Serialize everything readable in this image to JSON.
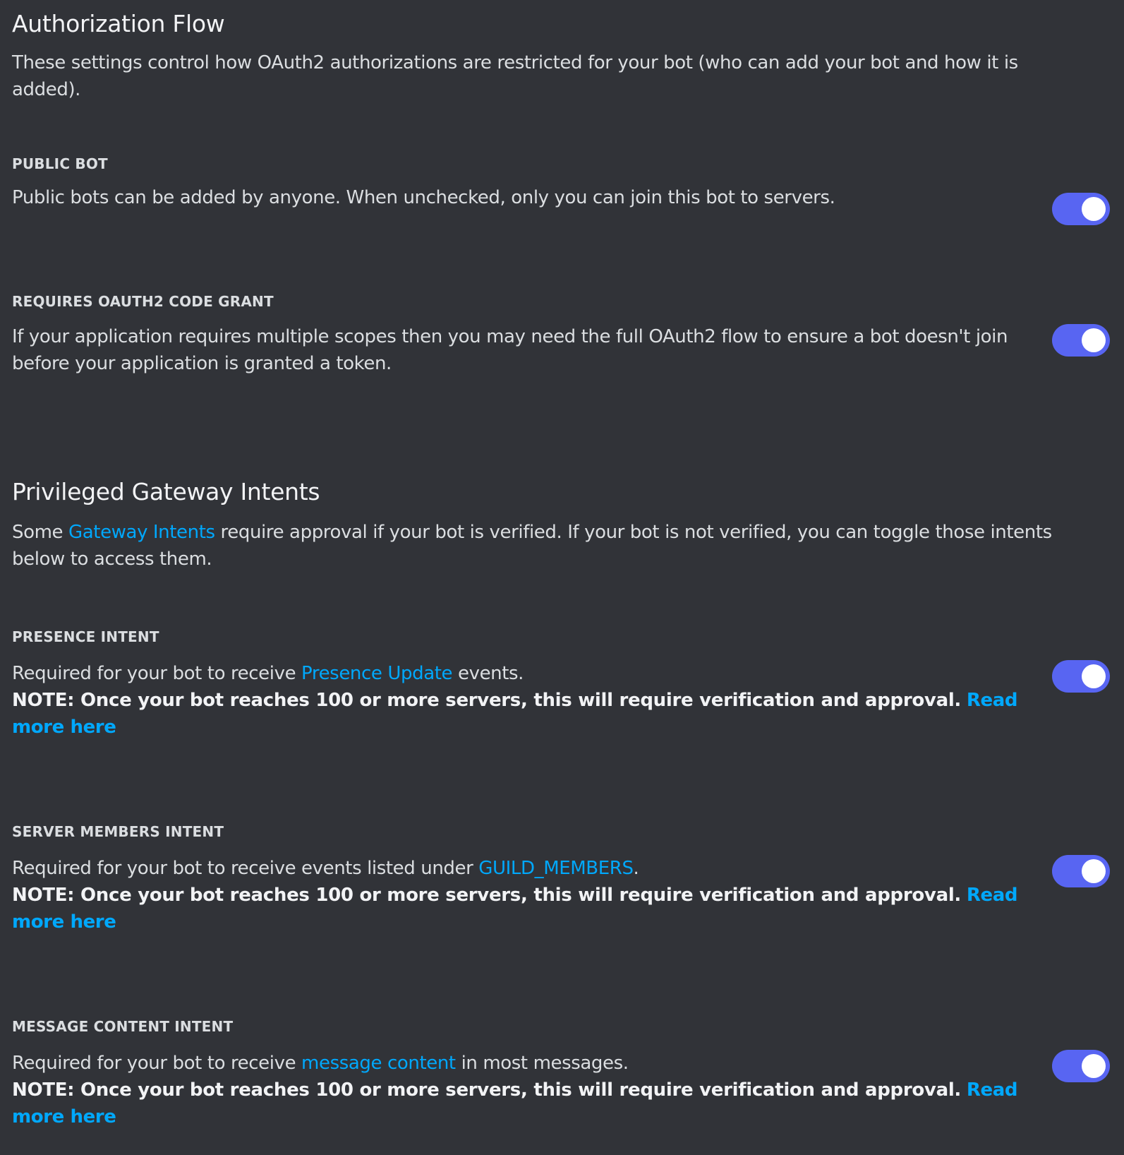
{
  "auth_flow": {
    "title": "Authorization Flow",
    "description": "These settings control how OAuth2 authorizations are restricted for your bot (who can add your bot and how it is added).",
    "public_bot": {
      "label": "PUBLIC BOT",
      "description": "Public bots can be added by anyone. When unchecked, only you can join this bot to servers.",
      "enabled": true
    },
    "requires_code_grant": {
      "label": "REQUIRES OAUTH2 CODE GRANT",
      "description": "If your application requires multiple scopes then you may need the full OAuth2 flow to ensure a bot doesn't join before your application is granted a token.",
      "enabled": true
    }
  },
  "intents": {
    "title": "Privileged Gateway Intents",
    "description_prefix": "Some ",
    "description_link": "Gateway Intents",
    "description_suffix": " require approval if your bot is verified. If your bot is not verified, you can toggle those intents below to access them.",
    "note_text": "NOTE: Once your bot reaches 100 or more servers, this will require verification and approval.",
    "read_more": "Read more here",
    "presence": {
      "label": "PRESENCE INTENT",
      "desc_prefix": "Required for your bot to receive ",
      "desc_link": "Presence Update",
      "desc_suffix": " events.",
      "enabled": true
    },
    "server_members": {
      "label": "SERVER MEMBERS INTENT",
      "desc_prefix": "Required for your bot to receive events listed under ",
      "desc_link": "GUILD_MEMBERS",
      "desc_suffix": ".",
      "enabled": true
    },
    "message_content": {
      "label": "MESSAGE CONTENT INTENT",
      "desc_prefix": "Required for your bot to receive ",
      "desc_link": "message content",
      "desc_suffix": " in most messages.",
      "enabled": true
    }
  },
  "colors": {
    "background": "#313338",
    "toggle_on": "#5865f2",
    "link": "#00a8fc",
    "text": "#dbdee1",
    "heading": "#f2f3f5"
  }
}
